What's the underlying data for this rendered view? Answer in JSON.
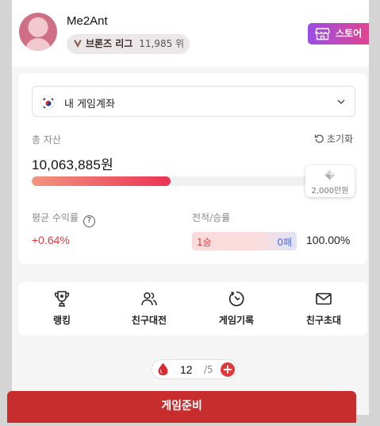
{
  "profile": {
    "nickname": "Me2Ant",
    "league_name": "브론즈 리그",
    "league_rank": "11,985 위",
    "store_label": "스토어"
  },
  "account": {
    "selected": "내 게임계좌",
    "flag_icon": "korea-flag-icon"
  },
  "assets": {
    "total_label": "총 자산",
    "reset_label": "초기화",
    "total_value": "10,063,885원",
    "progress_fraction": 0.48,
    "goal_label": "2,000만원",
    "avg_return_label": "평균 수익률",
    "help_glyph": "?",
    "avg_return_value": "+0.64%",
    "record_label": "전적/승률",
    "wins": "1승",
    "losses": "0패",
    "win_rate": "100.00%"
  },
  "menu": {
    "items": [
      {
        "label": "랭킹",
        "icon": "trophy-icon"
      },
      {
        "label": "친구대전",
        "icon": "friends-icon"
      },
      {
        "label": "게임기록",
        "icon": "history-icon"
      },
      {
        "label": "친구초대",
        "icon": "mail-icon"
      }
    ]
  },
  "energy": {
    "count": "12",
    "max": "/5",
    "add_glyph": "+"
  },
  "ready_button": "게임준비",
  "colors": {
    "accent_red": "#c72d2d",
    "profit_red": "#e5393d",
    "loss_blue": "#4a6fe0",
    "store_gradient": [
      "#9b4de6",
      "#e0458f"
    ]
  }
}
